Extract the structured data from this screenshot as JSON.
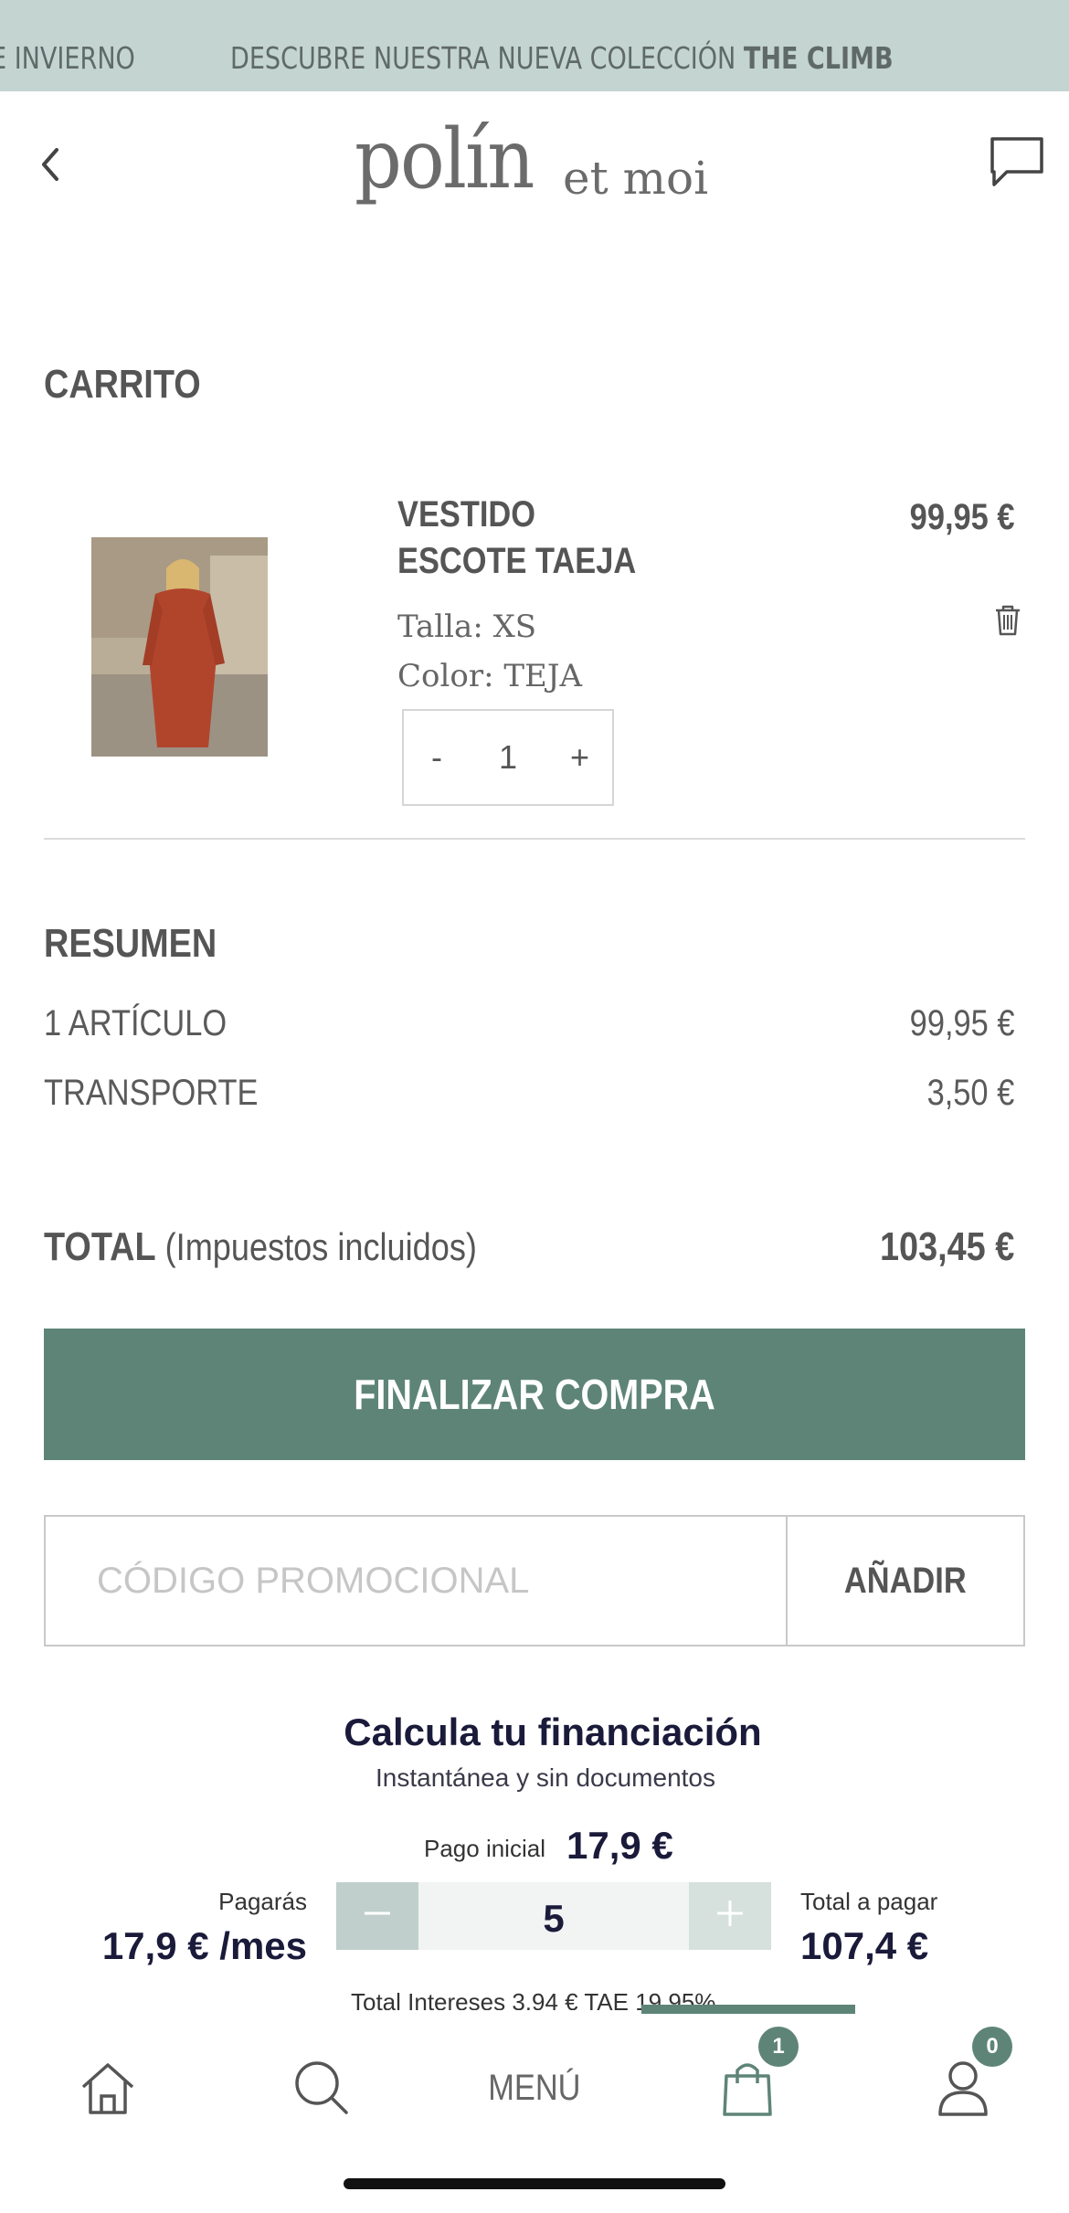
{
  "banner": {
    "left_fragment": "E INVIERNO",
    "text": "DESCUBRE NUESTRA NUEVA COLECCIÓN ",
    "highlight": "THE CLIMB",
    "color": "#c4d4d0"
  },
  "header": {
    "logo_main": "polín",
    "logo_sub": "et moi",
    "back_icon": "chevron-left-icon",
    "chat_icon": "chat-bubble-icon"
  },
  "cart": {
    "title": "CARRITO",
    "items": [
      {
        "name": "VESTIDO ESCOTE TAEJA",
        "price": "99,95 €",
        "size": "Talla: XS",
        "color": "Color: TEJA",
        "quantity": "1",
        "qty_minus": "-",
        "qty_plus": "+"
      }
    ]
  },
  "summary": {
    "title": "RESUMEN",
    "items_label": "1 ARTÍCULO",
    "items_value": "99,95 €",
    "shipping_label": "TRANSPORTE",
    "shipping_value": "3,50 €",
    "total_label": "TOTAL",
    "total_note": "(Impuestos incluidos)",
    "total_value": "103,45 €"
  },
  "checkout": {
    "label": "FINALIZAR COMPRA",
    "color": "#5e8478"
  },
  "promo": {
    "placeholder": "CÓDIGO PROMOCIONAL",
    "button": "AÑADIR"
  },
  "financing": {
    "title": "Calcula tu financiación",
    "subtitle": "Instantánea y sin documentos",
    "initial_label": "Pago inicial",
    "initial_value": "17,9 €",
    "monthly_label": "Pagarás",
    "monthly_value": "17,9 € /mes",
    "months": "5",
    "total_label": "Total a pagar",
    "total_value": "107,4 €",
    "interest_text": "Total Intereses 3,94 €  TAE 19,95%"
  },
  "tabbar": {
    "menu_label": "MENÚ",
    "cart_badge": "1",
    "user_badge": "0",
    "home_icon": "home-icon",
    "search_icon": "search-icon",
    "cart_icon": "shopping-bag-icon",
    "user_icon": "user-icon"
  }
}
